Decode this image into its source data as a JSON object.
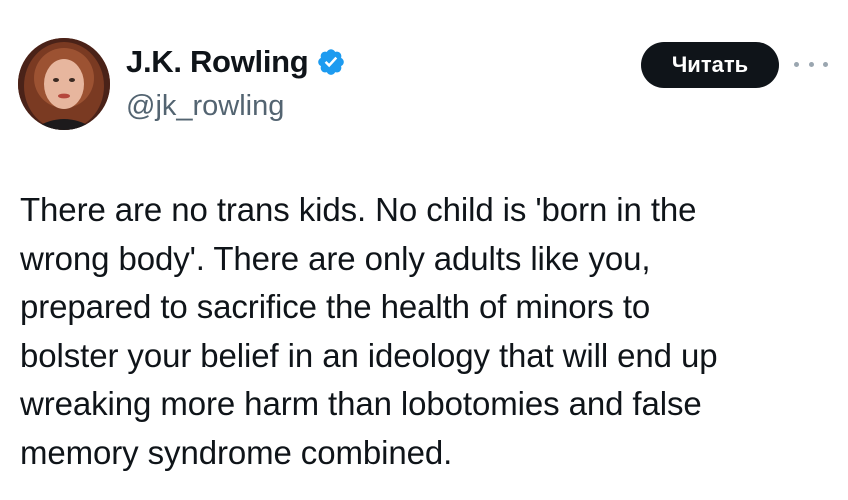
{
  "author": {
    "display_name": "J.K. Rowling",
    "handle": "@jk_rowling",
    "verified": true,
    "verified_icon": "verified-badge-icon",
    "verified_color": "#1d9bf0"
  },
  "actions": {
    "read_label": "Читать",
    "more_icon": "more-dots-icon"
  },
  "tweet": {
    "lines": [
      "There are no trans kids. No child is 'born in the",
      "wrong body'. There are only adults like you,",
      "prepared to sacrifice the health of minors to",
      "bolster your belief in an ideology that will end up",
      "wreaking more harm than lobotomies and false",
      "memory syndrome combined."
    ]
  },
  "colors": {
    "text": "#0f1419",
    "secondary": "#536471",
    "button_bg": "#0f1419",
    "button_text": "#ffffff"
  }
}
